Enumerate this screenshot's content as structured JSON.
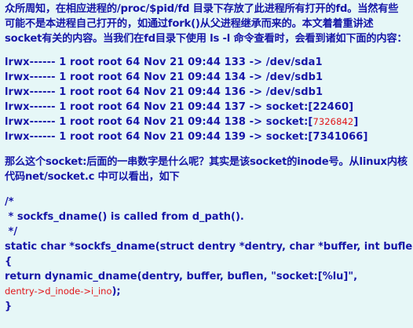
{
  "intro_text": "众所周知，在相应进程的/proc/$pid/fd 目录下存放了此进程所有打开的fd。当然有些可能不是本进程自己打开的，如通过fork()从父进程继承而来的。本文着着重讲述socket有关的内容。当我们在fd目录下使用 ls -l 命令查看时，会看到诸如下面的内容：",
  "listing": [
    {
      "text": "lrwx------ 1 root root 64 Nov 21 09:44 133 -> /dev/sda1",
      "red": ""
    },
    {
      "text": "lrwx------ 1 root root 64 Nov 21 09:44 134 -> /dev/sdb1",
      "red": ""
    },
    {
      "text": "lrwx------ 1 root root 64 Nov 21 09:44 136 -> /dev/sdb1",
      "red": ""
    },
    {
      "text": "lrwx------ 1 root root 64 Nov 21 09:44 137 -> socket:[22460]",
      "red": ""
    },
    {
      "text": "lrwx------ 1 root root 64 Nov 21 09:44 138 -> socket:[",
      "red": "7326842",
      "tail": "]"
    },
    {
      "text": "lrwx------ 1 root root 64 Nov 21 09:44 139 -> socket:[7341066]",
      "red": ""
    }
  ],
  "question_text": "那么这个socket:后面的一串数字是什么呢？其实是该socket的inode号。从linux内核代码net/socket.c 中可以看出，如下",
  "code": {
    "l1": "/*",
    "l2": " * sockfs_dname() is called from d_path().",
    "l3": " */",
    "l4": "static char *sockfs_dname(struct dentry *dentry, char *buffer, int buflen)",
    "l5": "{",
    "l6": "return dynamic_dname(dentry, buffer, buflen, \"socket:[%lu]\",",
    "l7": "dentry->d_inode->i_ino",
    "l7_tail": ");",
    "l8": "}"
  }
}
